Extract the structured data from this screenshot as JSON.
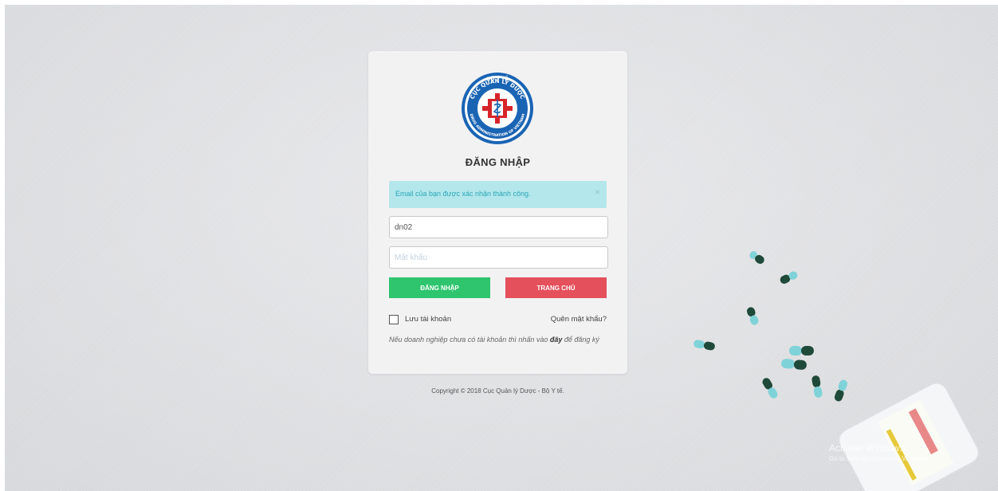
{
  "login": {
    "title": "ĐĂNG NHẬP",
    "alert_message": "Email của bạn được xác nhận thành công.",
    "alert_close": "×",
    "username_value": "dn02",
    "password_placeholder": "Mật khẩu",
    "login_button": "ĐĂNG NHẬP",
    "home_button": "TRANG CHỦ",
    "remember_label": "Lưu tài khoản",
    "forgot_link": "Quên mật khẩu?",
    "note_before": "Nếu doanh nghiệp chưa có tài khoản thì nhấn vào ",
    "note_link": "đây",
    "note_after": " để đăng ký"
  },
  "logo": {
    "top_text": "BỘ Y TẾ",
    "ring_text": "CỤC QUẢN LÝ DƯỢC",
    "bottom_text": "DRUG ADMINISTRATION OF VIETNAM",
    "abbr": "D.A.V"
  },
  "footer": {
    "copyright": "Copyright © 2018 Cục Quản lý Dược - Bộ Y tế."
  },
  "watermark": {
    "line1": "Activate Windows",
    "line2": "Go to Settings to activate Windows."
  },
  "colors": {
    "login_button": "#2ec56e",
    "home_button": "#e4505b",
    "alert_bg": "#b3e7ec",
    "alert_text": "#2aa6b8"
  }
}
